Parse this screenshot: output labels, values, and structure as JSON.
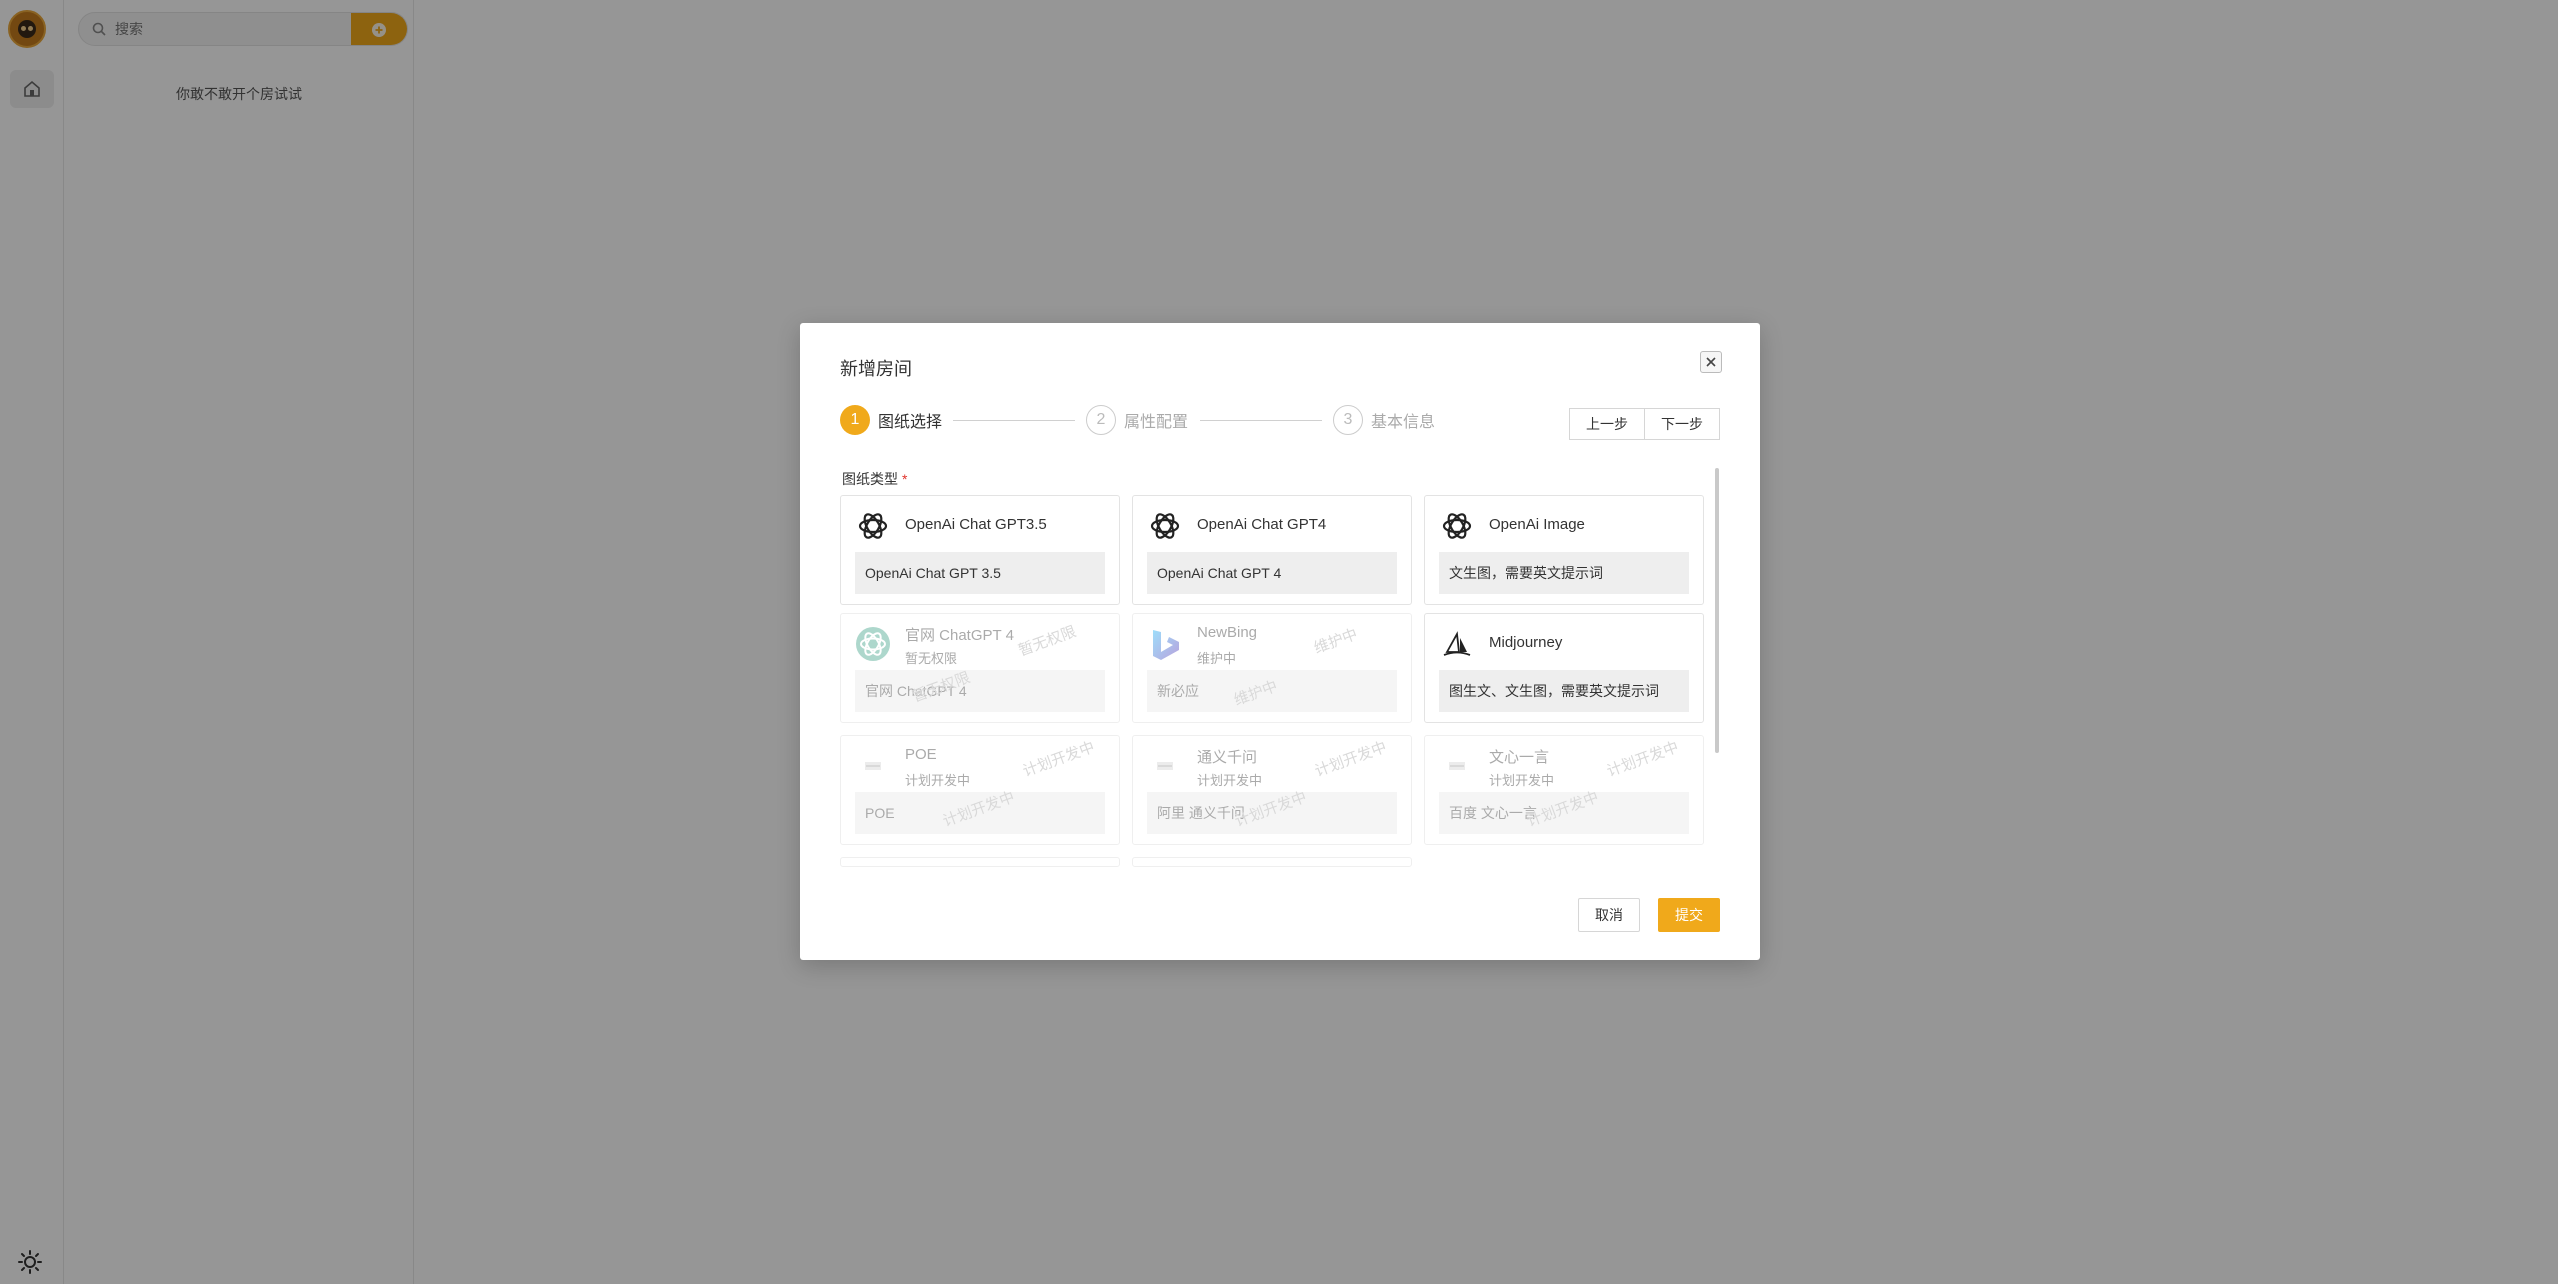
{
  "sidebar": {
    "home_icon": "home-icon",
    "theme_icon": "sun-icon"
  },
  "room_panel": {
    "search_placeholder": "搜索",
    "add_icon": "plus-circle-icon",
    "empty_text": "你敢不敢开个房试试"
  },
  "modal": {
    "title": "新增房间",
    "steps": [
      {
        "num": "1",
        "label": "图纸选择",
        "active": true
      },
      {
        "num": "2",
        "label": "属性配置",
        "active": false
      },
      {
        "num": "3",
        "label": "基本信息",
        "active": false
      }
    ],
    "prev_label": "上一步",
    "next_label": "下一步",
    "field_label": "图纸类型",
    "required_mark": "*",
    "cards": [
      {
        "name": "OpenAi Chat GPT3.5",
        "desc": "OpenAi Chat GPT 3.5",
        "icon": "openai-icon",
        "enabled": true
      },
      {
        "name": "OpenAi Chat GPT4",
        "desc": "OpenAi Chat GPT 4",
        "icon": "openai-icon",
        "enabled": true
      },
      {
        "name": "OpenAi Image",
        "desc": "文生图，需要英文提示词",
        "icon": "openai-icon",
        "enabled": true
      },
      {
        "name": "官网 ChatGPT 4",
        "sub": "暂无权限",
        "desc": "官网 ChatGPT 4",
        "icon": "openai-icon",
        "enabled": false,
        "watermark": "暂无权限"
      },
      {
        "name": "NewBing",
        "sub": "维护中",
        "desc": "新必应",
        "icon": "bing-icon",
        "enabled": false,
        "watermark": "维护中"
      },
      {
        "name": "Midjourney",
        "desc": "图生文、文生图，需要英文提示词",
        "icon": "midjourney-icon",
        "enabled": true
      },
      {
        "name": "POE",
        "sub": "计划开发中",
        "desc": "POE",
        "icon": "placeholder-logo-icon",
        "enabled": false,
        "watermark": "计划开发中"
      },
      {
        "name": "通义千问",
        "sub": "计划开发中",
        "desc": "阿里 通义千问",
        "icon": "placeholder-logo-icon",
        "enabled": false,
        "watermark": "计划开发中"
      },
      {
        "name": "文心一言",
        "sub": "计划开发中",
        "desc": "百度 文心一言",
        "icon": "placeholder-logo-icon",
        "enabled": false,
        "watermark": "计划开发中"
      }
    ],
    "cancel_label": "取消",
    "submit_label": "提交"
  },
  "colors": {
    "accent": "#f0a91b",
    "overlay": "rgba(0,0,0,0.41)",
    "required": "#e0322b"
  }
}
